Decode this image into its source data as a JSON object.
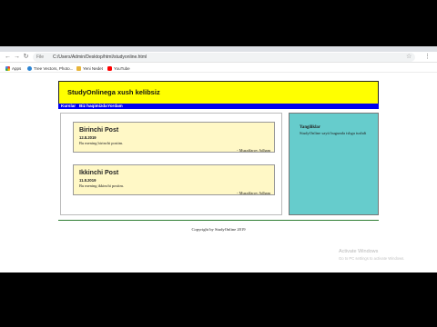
{
  "browser": {
    "nav": {
      "back": "←",
      "forward": "→",
      "reload": "↻"
    },
    "url_info": "File",
    "url": "C:/Users/Admin/Desktop/html/studyonline.html",
    "star": "☆",
    "menu": "⋮",
    "bookmarks": [
      {
        "label": "Apps",
        "icon": "apps-grid-icon"
      },
      {
        "label": "Tree Vectors, Photo...",
        "icon": "tvd-icon"
      },
      {
        "label": "Yeni Nedet",
        "icon": "yn-icon"
      },
      {
        "label": "YouTube",
        "icon": "youtube-icon"
      }
    ]
  },
  "page": {
    "site_title": "StudyOnlinega xush kelibsiz",
    "nav": [
      "Kurslar",
      "Biz haqimizda",
      "Yordam"
    ],
    "posts": [
      {
        "title": "Birinchi Post",
        "date": "12.8.2019",
        "body": "Bu mening birinchi postim.",
        "author": "- Muzaffarov Adham"
      },
      {
        "title": "Ikkinchi Post",
        "date": "11.8.2019",
        "body": "Bu mening ikkinchi postim.",
        "author": "- Muzaffarov Adham"
      }
    ],
    "sidebar": {
      "title": "Yangiliklar",
      "text": "StudyOnline sayti bugunda ishga tushdi"
    },
    "footer": "Copyright by StudyOnline 2019"
  },
  "os_watermark": {
    "title": "Activate Windows",
    "subtitle": "Go to PC settings to activate Windows."
  },
  "colors": {
    "header_bg": "#ffff00",
    "navbar_bg": "#0000ee",
    "post_bg": "#fff8c6",
    "sidebar_bg": "#66cccc",
    "footer_line": "#2e7d32"
  }
}
